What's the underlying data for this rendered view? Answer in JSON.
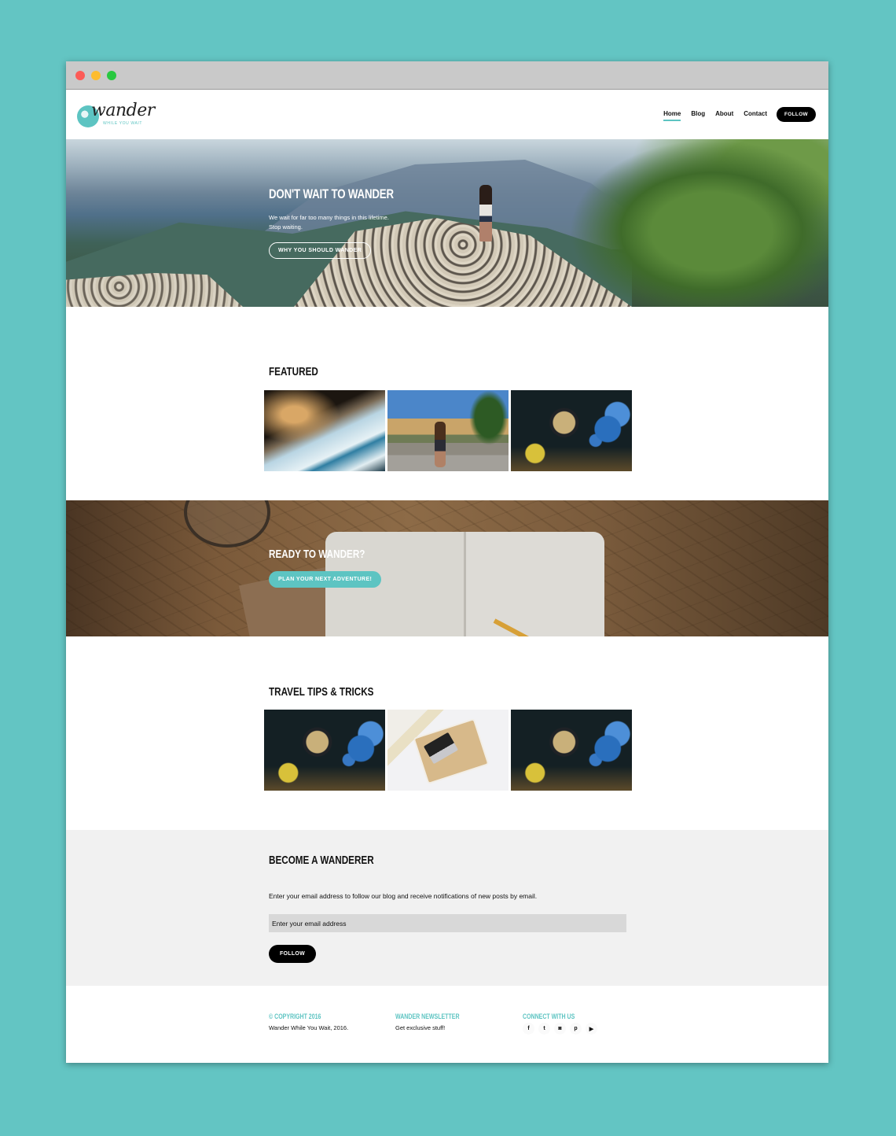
{
  "browser": {
    "controls": [
      "close",
      "minimize",
      "maximize"
    ]
  },
  "brand": {
    "logo_word": "wander",
    "logo_tagline": "WHILE YOU WAIT"
  },
  "nav": {
    "items": [
      {
        "label": "Home",
        "active": true
      },
      {
        "label": "Blog",
        "active": false
      },
      {
        "label": "About",
        "active": false
      },
      {
        "label": "Contact",
        "active": false
      }
    ],
    "follow_label": "FOLLOW"
  },
  "hero": {
    "title": "DON'T WAIT TO WANDER",
    "text_line1": "We wait for far too many things in this lifetime.",
    "text_line2": "Stop waiting.",
    "button_label": "WHY YOU SHOULD WANDER"
  },
  "featured": {
    "title": "FEATURED",
    "items": [
      {
        "image": "coastline-waves"
      },
      {
        "image": "positano-woman-on-bench"
      },
      {
        "image": "vintage-globes"
      }
    ]
  },
  "cta": {
    "title": "READY TO WANDER?",
    "button_label": "PLAN YOUR NEXT ADVENTURE!"
  },
  "tips": {
    "title": "TRAVEL TIPS & TRICKS",
    "items": [
      {
        "image": "vintage-globes"
      },
      {
        "image": "laptop-on-tray"
      },
      {
        "image": "vintage-globes"
      }
    ]
  },
  "subscribe": {
    "title": "BECOME A WANDERER",
    "text": "Enter your email address to follow our blog and receive notifications of new posts by email.",
    "input_placeholder": "Enter your email address",
    "input_value": "",
    "button_label": "FOLLOW"
  },
  "footer": {
    "copyright_heading": "© COPYRIGHT 2016",
    "copyright_text": "Wander While You Wait, 2016.",
    "newsletter_heading": "WANDER NEWSLETTER",
    "newsletter_text": "Get exclusive stuff!",
    "connect_heading": "CONNECT WITH US",
    "socials": [
      {
        "name": "facebook",
        "glyph": "f"
      },
      {
        "name": "twitter",
        "glyph": "t"
      },
      {
        "name": "instagram",
        "glyph": "◙"
      },
      {
        "name": "pinterest",
        "glyph": "p"
      },
      {
        "name": "youtube",
        "glyph": "▶"
      }
    ]
  },
  "colors": {
    "accent": "#5dc4c2",
    "backdrop": "#63c5c3",
    "button_dark": "#000000",
    "subscribe_bg": "#f1f1f1"
  }
}
